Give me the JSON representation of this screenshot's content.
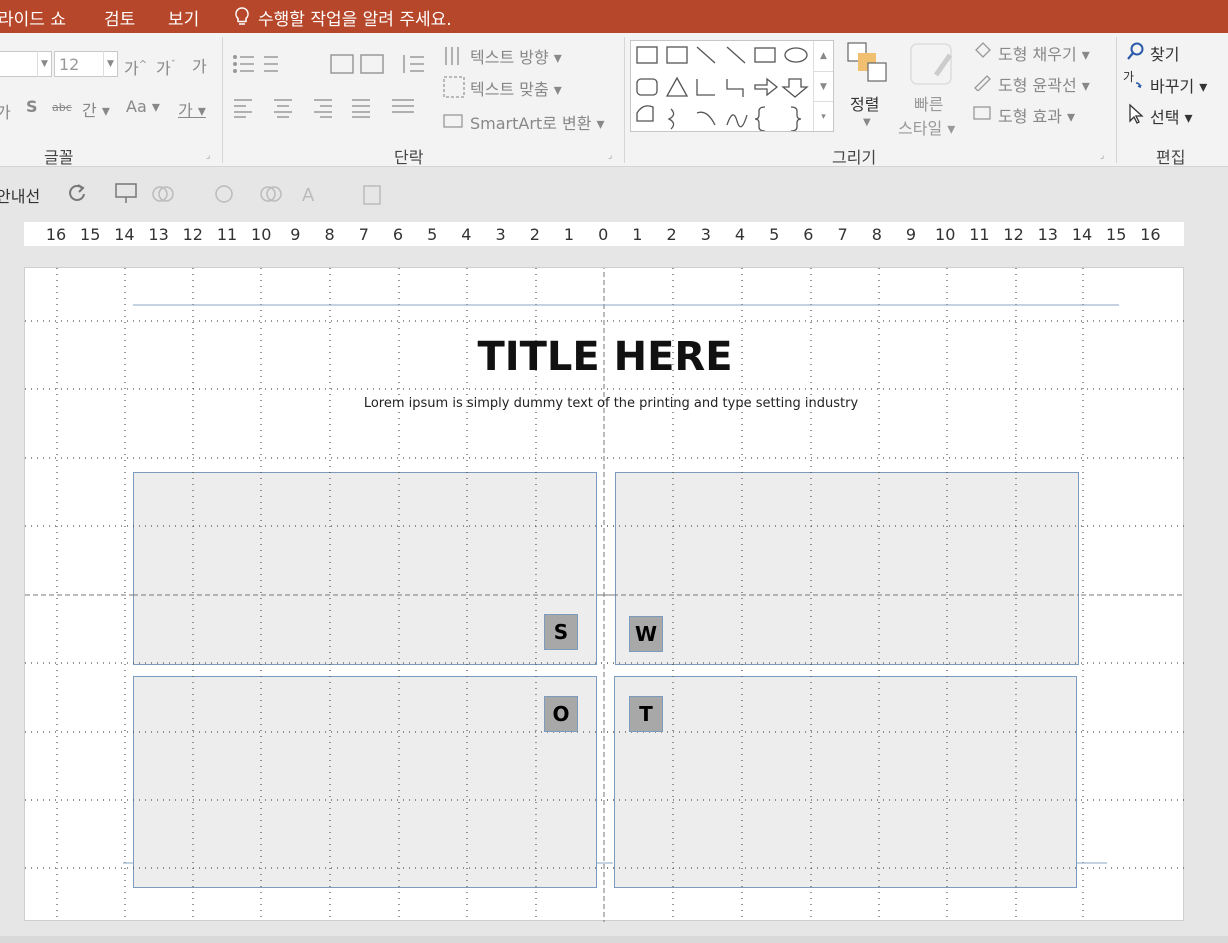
{
  "tabs": {
    "slideshow": "라이드 쇼",
    "review": "검토",
    "view": "보기",
    "tell_me": "수행할 작업을 알려 주세요."
  },
  "font_group": {
    "size_value": "12",
    "grow_label": "가",
    "shrink_label": "가",
    "clear_label": "가",
    "bold_partial": "가",
    "shadow_label": "S",
    "strike_label": "abc",
    "spacing_label": "간",
    "case_label": "Aa",
    "color_label": "가",
    "label": "글꼴"
  },
  "paragraph_group": {
    "text_direction": "텍스트 방향",
    "align_text": "텍스트 맞춤",
    "smartart": "SmartArt로 변환",
    "label": "단락"
  },
  "drawing_group": {
    "arrange": "정렬",
    "quick_styles_1": "빠른",
    "quick_styles_2": "스타일",
    "shape_fill": "도형 채우기",
    "shape_outline": "도형 윤곽선",
    "shape_effects": "도형 효과",
    "label": "그리기"
  },
  "editing_group": {
    "find": "찾기",
    "replace": "바꾸기",
    "select": "선택",
    "label": "편집"
  },
  "quick_access": {
    "guides_label": "안내선"
  },
  "ruler": {
    "ticks": [
      "16",
      "15",
      "14",
      "13",
      "12",
      "11",
      "10",
      "9",
      "8",
      "7",
      "6",
      "5",
      "4",
      "3",
      "2",
      "1",
      "0",
      "1",
      "2",
      "3",
      "4",
      "5",
      "6",
      "7",
      "8",
      "9",
      "10",
      "11",
      "12",
      "13",
      "14",
      "15",
      "16"
    ]
  },
  "slide": {
    "title": "TITLE HERE",
    "subtitle": "Lorem ipsum is simply dummy text of the printing and type setting industry",
    "swot": [
      "S",
      "W",
      "O",
      "T"
    ]
  },
  "colors": {
    "accent": "#b7472a",
    "box_fill": "#ededed",
    "tile_fill": "#a8a8a8",
    "outline": "#7b9bbf"
  }
}
